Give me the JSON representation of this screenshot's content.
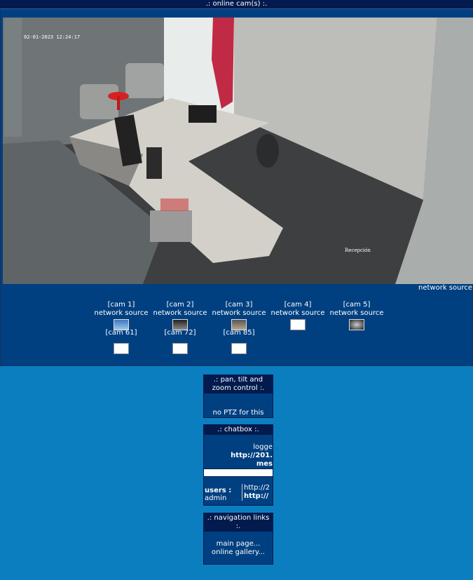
{
  "header": {
    "title": ".: online cam(s) :."
  },
  "main_cam": {
    "timestamp": "02-01-2023 12:24:17",
    "watermark": "Recepción",
    "source_label": "network source"
  },
  "cams": [
    {
      "label": "[cam 1]",
      "source": "network source",
      "thumb": "image"
    },
    {
      "label": "[cam 2]",
      "source": "network source",
      "thumb": "image"
    },
    {
      "label": "[cam 3]",
      "source": "network source",
      "thumb": "image"
    },
    {
      "label": "[cam 4]",
      "source": "network source",
      "thumb": "blank"
    },
    {
      "label": "[cam 5]",
      "source": "network source",
      "thumb": "image"
    },
    {
      "label": "[cam 61]",
      "thumb": "blank"
    },
    {
      "label": "[cam 72]",
      "thumb": "blank"
    },
    {
      "label": "[cam 85]",
      "thumb": "blank"
    }
  ],
  "ptz": {
    "title": ".: pan, tilt and zoom control :.",
    "message": "no PTZ for this"
  },
  "chatbox": {
    "title": ".: chatbox :.",
    "line1": "logge",
    "line2": "http://201.",
    "line3": "mes",
    "users_label": "users :",
    "user": "admin",
    "url1": "http://2",
    "url2": "http://"
  },
  "nav": {
    "title": ".: navigation links :.",
    "links": [
      "main page...",
      "online gallery..."
    ]
  },
  "colors": {
    "background": "#0b7ec0",
    "panel": "#004080",
    "title_bar": "#021a4d"
  }
}
